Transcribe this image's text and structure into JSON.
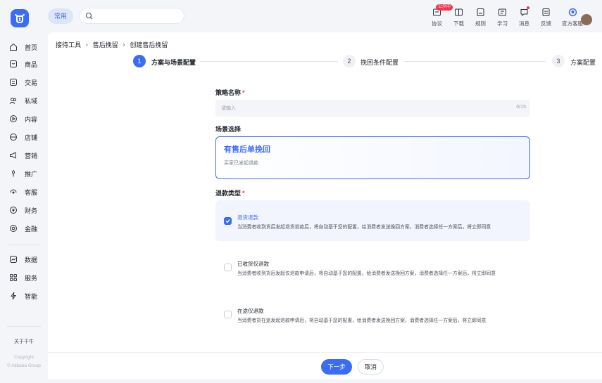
{
  "topbar": {
    "quick_label": "常用",
    "search_placeholder": "",
    "tools": [
      {
        "icon": "protocol-icon",
        "label": "协议",
        "badge": "公示中"
      },
      {
        "icon": "download-icon",
        "label": "下载"
      },
      {
        "icon": "rules-icon",
        "label": "规则"
      },
      {
        "icon": "learn-icon",
        "label": "学习"
      },
      {
        "icon": "message-icon",
        "label": "消息",
        "dot": true
      },
      {
        "icon": "feedback-icon",
        "label": "反馈"
      },
      {
        "icon": "customer-service-icon",
        "label": "官方客服"
      }
    ]
  },
  "sidebar": {
    "items": [
      {
        "icon": "home-icon",
        "label": "首页"
      },
      {
        "icon": "goods-icon",
        "label": "商品"
      },
      {
        "icon": "trade-icon",
        "label": "交易"
      },
      {
        "icon": "private-domain-icon",
        "label": "私域"
      },
      {
        "icon": "content-icon",
        "label": "内容"
      },
      {
        "icon": "shop-icon",
        "label": "店铺"
      },
      {
        "icon": "marketing-icon",
        "label": "营销"
      },
      {
        "icon": "promotion-icon",
        "label": "推广"
      },
      {
        "icon": "service-icon",
        "label": "客服"
      },
      {
        "icon": "finance-icon",
        "label": "财务"
      },
      {
        "icon": "banking-icon",
        "label": "金融"
      },
      {
        "icon": "data-icon",
        "label": "数据"
      },
      {
        "icon": "services-icon",
        "label": "服务"
      },
      {
        "icon": "intelligence-icon",
        "label": "智能"
      }
    ],
    "about": "关于千牛",
    "copyright_1": "Copyright",
    "copyright_2": "© Alibaba Group"
  },
  "breadcrumb": [
    "接待工具",
    "售后挽留",
    "创建售后挽留"
  ],
  "steps": [
    {
      "num": "1",
      "label": "方案与场景配置",
      "active": true
    },
    {
      "num": "2",
      "label": "挽回条件配置",
      "active": false
    },
    {
      "num": "3",
      "label": "方案配置",
      "active": false
    }
  ],
  "form": {
    "name_label": "策略名称",
    "required_mark": "*",
    "name_placeholder": "请输入",
    "name_count": "0/15",
    "scene_label": "场景选择",
    "scene_title": "有售后单挽回",
    "scene_desc": "买家已发起退款",
    "refund_label": "退款类型",
    "refund_options": [
      {
        "title": "退货退款",
        "desc": "当消费者收到货后发起退货退款后，将自动基于您的配置，给消费者发送挽回方案，消费者选择任一方案后，将立即同意",
        "checked": true
      },
      {
        "title": "已收货仅退款",
        "desc": "当消费者收到货后发起仅退款申请后，将自动基于您的配置，给消费者发送挽回方案，消费者选择任一方案后，将立即同意",
        "checked": false
      },
      {
        "title": "在途仅退款",
        "desc": "当消费者货在途发起退款申请后，将自动基于您的配置，给消费者发送挽回方案，消费者选择任一方案后，将立即同意",
        "checked": false
      }
    ]
  },
  "footer": {
    "next": "下一步",
    "cancel": "取消"
  },
  "colors": {
    "accent": "#3a6cf6",
    "required": "#f5334a"
  }
}
